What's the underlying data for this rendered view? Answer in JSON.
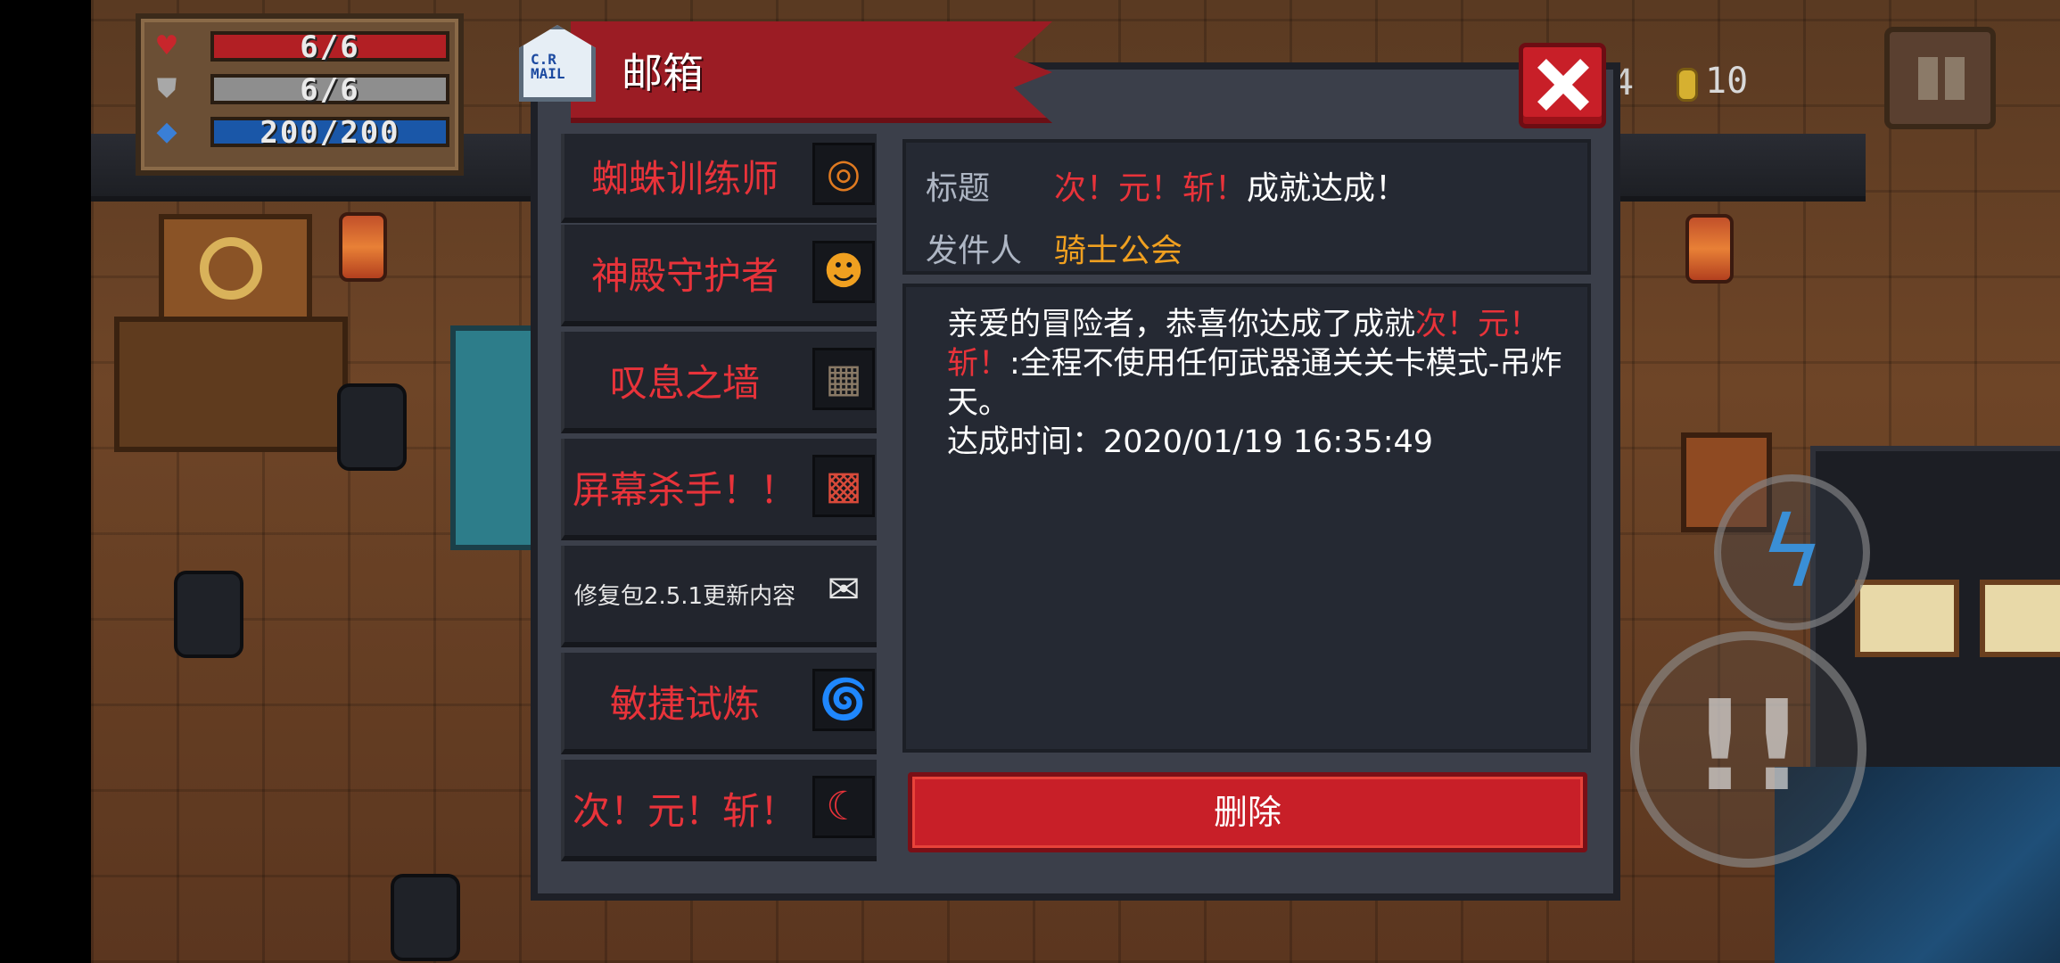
{
  "hud": {
    "hp": "6/6",
    "armor": "6/6",
    "energy": "200/200",
    "gem_count": "4",
    "coin_count": "10"
  },
  "mailbox": {
    "title": "邮箱",
    "icon_text": "C.R MAIL",
    "items": [
      {
        "label": "蜘蛛训练师",
        "icon": "spider-ring-icon"
      },
      {
        "label": "神殿守护者",
        "icon": "temple-guardian-icon"
      },
      {
        "label": "叹息之墙",
        "icon": "wall-icon"
      },
      {
        "label": "屏幕杀手！！",
        "icon": "screen-killer-icon"
      },
      {
        "label": "修复包2.5.1更新内容",
        "icon": "envelope-icon"
      },
      {
        "label": "敏捷试炼",
        "icon": "tornado-icon"
      },
      {
        "label": "次！元！斩！",
        "icon": "crescent-slash-icon"
      }
    ],
    "detail": {
      "title_label": "标题",
      "title_highlight": "次！元！斩！",
      "title_rest": "成就达成！",
      "sender_label": "发件人",
      "sender": "骑士公会",
      "body_prefix": "亲爱的冒险者，恭喜你达成了成就",
      "body_highlight": "次！元！斩！",
      "body_suffix": ":全程不使用任何武器通关关卡模式-吊炸天。",
      "time_line": "达成时间：2020/01/19 16:35:49"
    },
    "delete_label": "删除"
  },
  "colors": {
    "accent_red": "#e8333a",
    "banner_red": "#9b1c24",
    "sender_orange": "#f0a020",
    "panel": "#252933"
  }
}
